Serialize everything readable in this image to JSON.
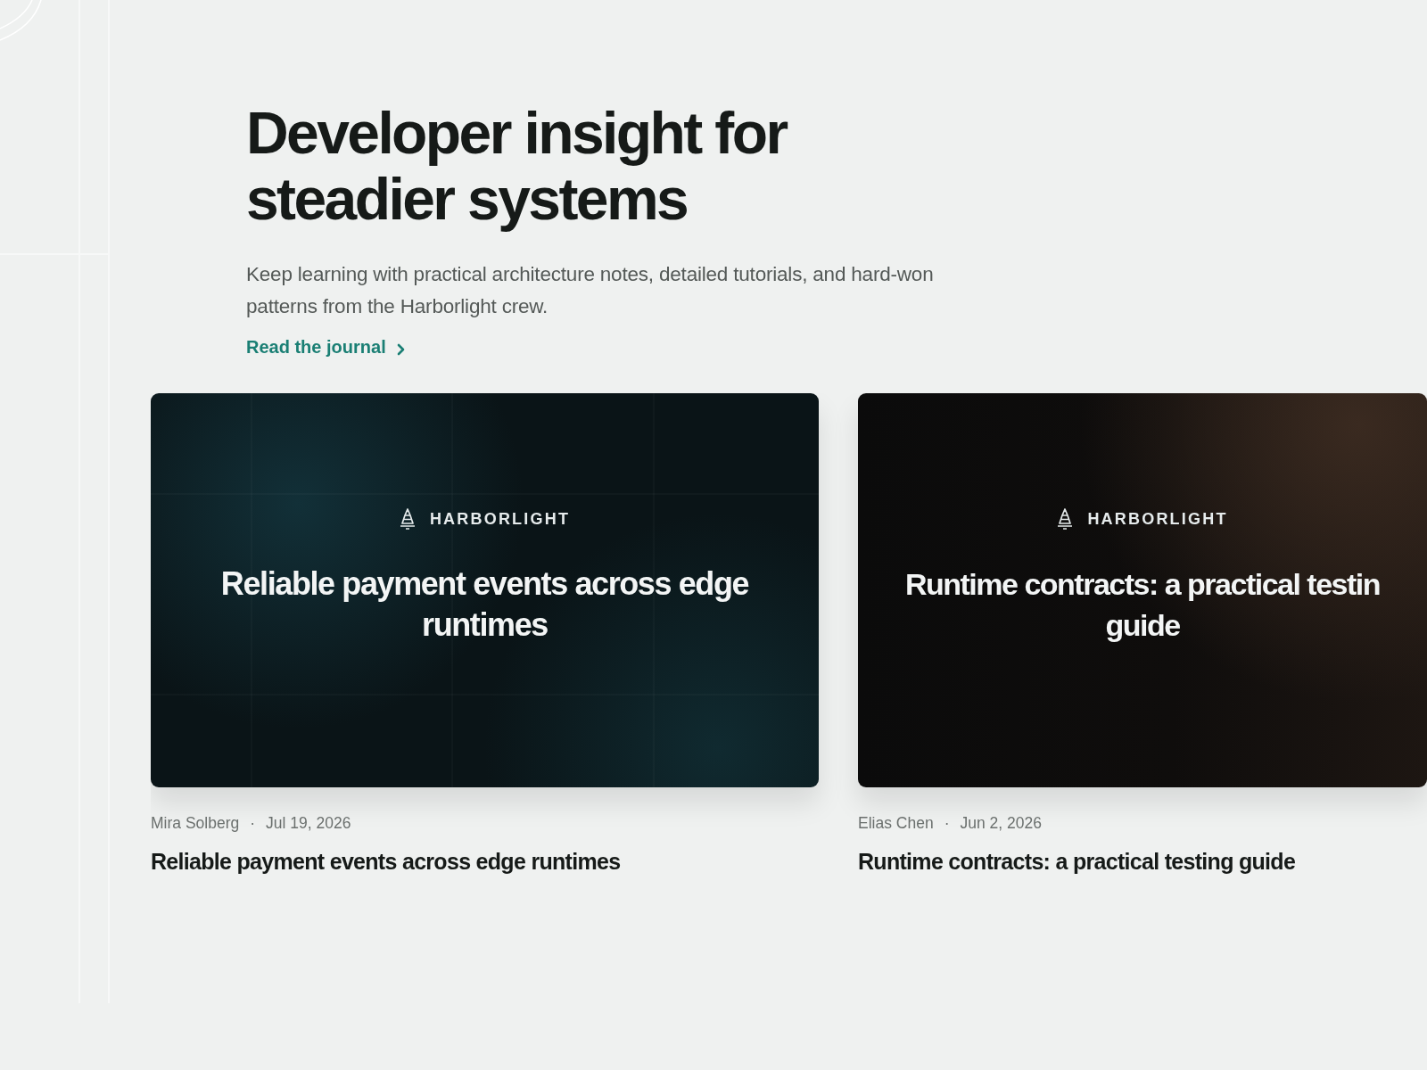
{
  "hero": {
    "title": "Developer insight for steadier systems",
    "subtitle": "Keep learning with practical architecture notes, detailed tutorials, and hard-won patterns from the Harborlight crew.",
    "link": "Read the journal"
  },
  "posts": [
    {
      "kind": "teal",
      "brand": "HARBORLIGHT",
      "cover_title": "Reliable payment events across edge runtimes",
      "author": "Mira Solberg",
      "separator": "·",
      "date": "Jul 19, 2026",
      "title": "Reliable payment events across edge runtimes"
    },
    {
      "kind": "amber",
      "brand": "HARBORLIGHT",
      "cover_title": "Runtime contracts: a practical testin\nguide",
      "author": "Elias Chen",
      "separator": "·",
      "date": "Jun 2, 2026",
      "title": "Runtime contracts: a practical testing guide"
    }
  ]
}
